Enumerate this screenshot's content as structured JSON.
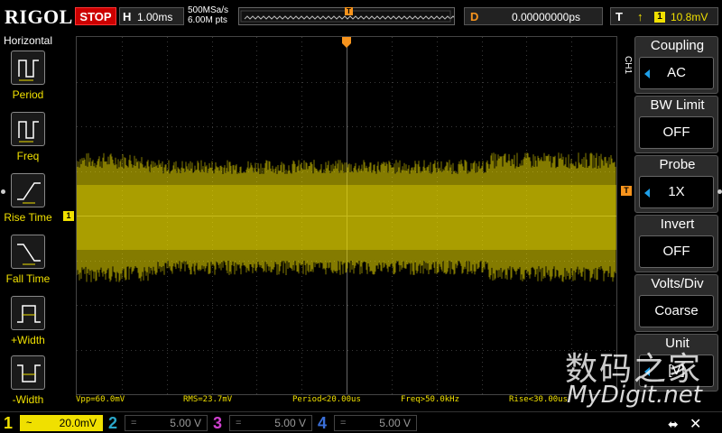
{
  "topbar": {
    "brand": "RIGOL",
    "run_state": "STOP",
    "horizontal_letter": "H",
    "timebase": "1.00ms",
    "sample_rate": "500MSa/s",
    "memory_depth": "6.00M pts",
    "delay_letter": "D",
    "delay_value": "0.00000000ps",
    "trigger_letter": "T",
    "trigger_source": "1",
    "trigger_level": "10.8mV"
  },
  "left_menu": {
    "title": "Horizontal",
    "items": [
      {
        "label": "Period",
        "icon": "period-icon"
      },
      {
        "label": "Freq",
        "icon": "freq-icon"
      },
      {
        "label": "Rise Time",
        "icon": "rise-time-icon"
      },
      {
        "label": "Fall Time",
        "icon": "fall-time-icon"
      },
      {
        "label": "+Width",
        "icon": "pos-width-icon"
      },
      {
        "label": "-Width",
        "icon": "neg-width-icon"
      }
    ]
  },
  "right_menu": {
    "channel_tag": "CH1",
    "items": [
      {
        "title": "Coupling",
        "value": "AC",
        "arrow": true
      },
      {
        "title": "BW Limit",
        "value": "OFF",
        "arrow": false
      },
      {
        "title": "Probe",
        "value": "1X",
        "arrow": true
      },
      {
        "title": "Invert",
        "value": "OFF",
        "arrow": false
      },
      {
        "title": "Volts/Div",
        "value": "Coarse",
        "arrow": false
      },
      {
        "title": "Unit",
        "value": "[V]",
        "arrow": true
      }
    ]
  },
  "markers": {
    "trigger_position": "T",
    "ch1_ground": "1",
    "trigger_level": "T"
  },
  "measurements": {
    "vpp": "Vpp=60.0mV",
    "rms": "RMS=23.7mV",
    "period": "Period<20.00us",
    "freq": "Freq>50.0kHz",
    "rise": "Rise<30.00us"
  },
  "channels": [
    {
      "num": "1",
      "coupling": "~",
      "scale": "20.0mV",
      "color": "#f0e000",
      "active": true
    },
    {
      "num": "2",
      "coupling": "=",
      "scale": "5.00 V",
      "color": "#2aa7c9",
      "active": false
    },
    {
      "num": "3",
      "coupling": "=",
      "scale": "5.00 V",
      "color": "#d040d0",
      "active": false
    },
    {
      "num": "4",
      "coupling": "=",
      "scale": "5.00 V",
      "color": "#3a6fd8",
      "active": false
    }
  ],
  "watermark": {
    "cn": "数码之家",
    "en": "MyDigit.net"
  },
  "colors": {
    "ch1": "#f0e000",
    "trigger": "#f7941d",
    "accent_blue": "#1e9fe8",
    "stop": "#cc0000"
  }
}
